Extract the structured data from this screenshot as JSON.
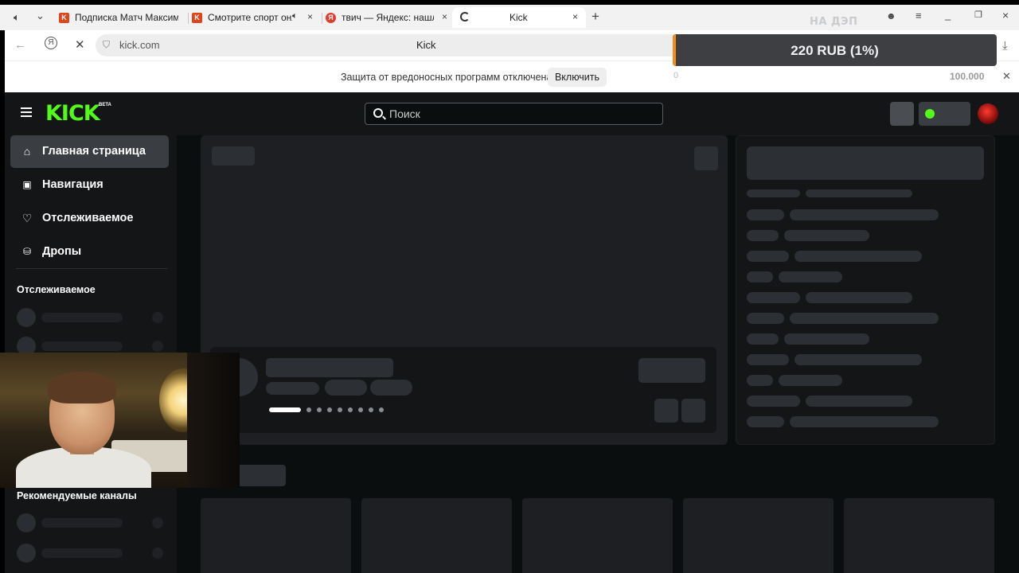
{
  "browser": {
    "tabs": [
      {
        "title": "Подписка Матч Максиму",
        "favicon": "kick-icon",
        "color": "#e0441b"
      },
      {
        "title": "Смотрите спорт онл",
        "favicon": "kick-icon",
        "color": "#e0441b"
      },
      {
        "title": "твич — Яндекс: нашлос",
        "favicon": "yandex-icon",
        "color": "#e23b2e"
      },
      {
        "title": "Kick",
        "favicon": "loading-spinner-icon"
      }
    ],
    "address": {
      "url": "kick.com",
      "page_title": "Kick"
    },
    "protection": {
      "message": "Защита от вредоносных программ отключена",
      "button": "Включить"
    }
  },
  "donation": {
    "title": "НА ДЭП",
    "amount_text": "220 RUB (1%)",
    "progress": 0.01,
    "min": "0",
    "max": "100.000",
    "fill_color": "#f28c1b"
  },
  "kick": {
    "logo": "KICK",
    "beta": "BETA",
    "accent": "#53fc18",
    "search_placeholder": "Поиск",
    "nav": [
      {
        "label": "Главная страница",
        "icon": "home-icon",
        "active": true
      },
      {
        "label": "Навигация",
        "icon": "browse-icon",
        "active": false
      },
      {
        "label": "Отслеживаемое",
        "icon": "heart-icon",
        "active": false
      },
      {
        "label": "Дропы",
        "icon": "drops-icon",
        "active": false
      }
    ],
    "following_heading": "Отслеживаемое",
    "recommended_heading": "Рекомендуемые каналы"
  }
}
